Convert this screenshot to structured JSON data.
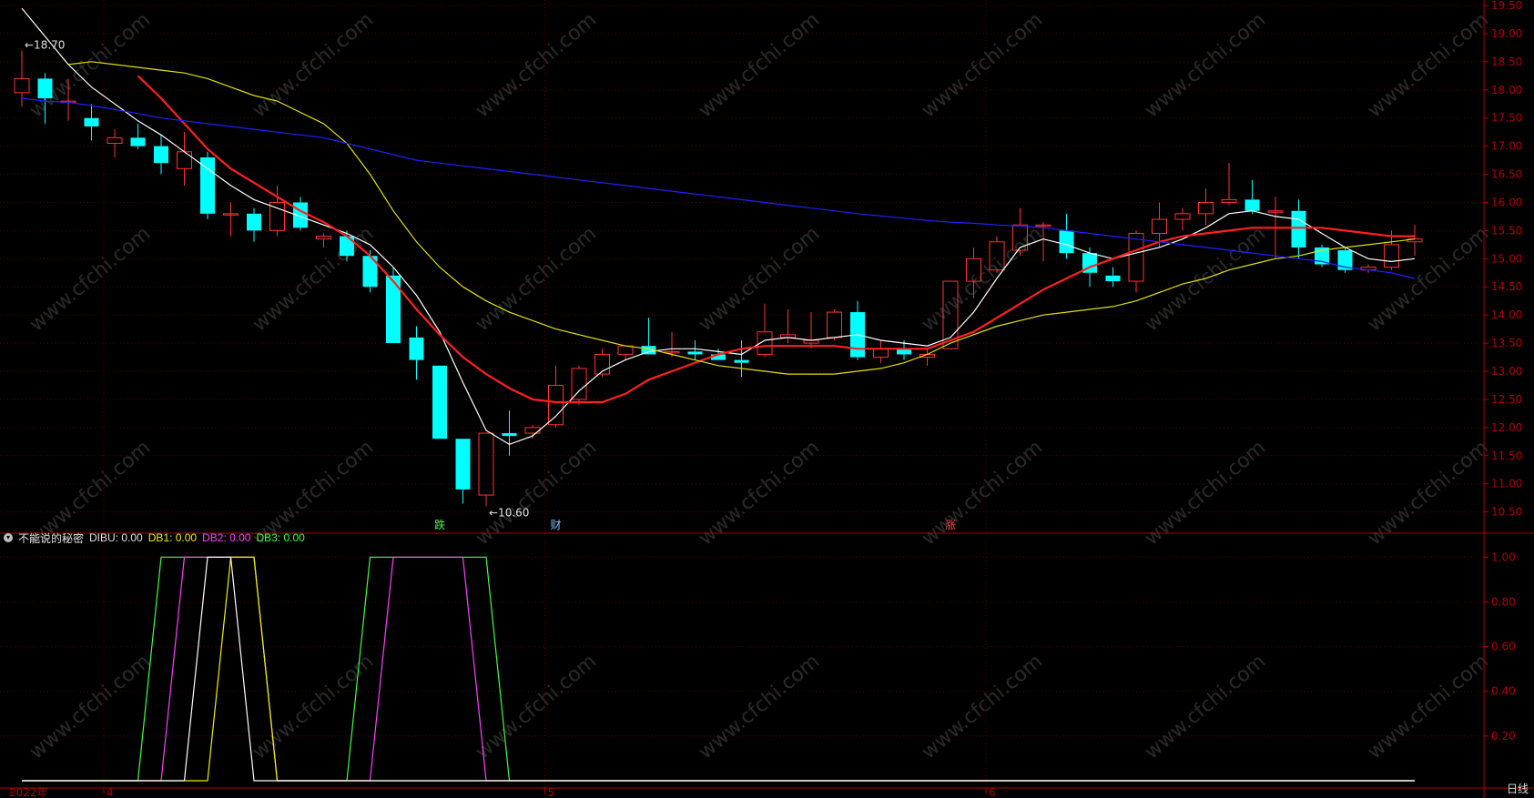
{
  "chart_data": [
    {
      "type": "candlestick",
      "ylim": [
        10.3,
        19.5
      ],
      "y_ticks": [
        "10.50",
        "11.00",
        "11.50",
        "12.00",
        "12.50",
        "13.00",
        "13.50",
        "14.00",
        "14.50",
        "15.00",
        "15.50",
        "16.00",
        "16.50",
        "17.00",
        "17.50",
        "18.00",
        "18.50",
        "19.00",
        "19.50"
      ],
      "price_annotations": [
        {
          "text": "18.70",
          "bar": 0,
          "value": 18.7
        },
        {
          "text": "10.60",
          "bar": 20,
          "value": 10.6
        }
      ],
      "event_markers": [
        {
          "text": "跌",
          "bar": 18,
          "color": "#40ff40"
        },
        {
          "text": "财",
          "bar": 23,
          "color": "#80c0ff"
        },
        {
          "text": "涨",
          "bar": 40,
          "color": "#ff4040"
        }
      ],
      "candles": [
        {
          "o": 17.95,
          "h": 18.7,
          "l": 17.7,
          "c": 18.2
        },
        {
          "o": 18.2,
          "h": 18.3,
          "l": 17.4,
          "c": 17.85
        },
        {
          "o": 17.8,
          "h": 18.2,
          "l": 17.45,
          "c": 17.8
        },
        {
          "o": 17.5,
          "h": 17.75,
          "l": 17.1,
          "c": 17.35
        },
        {
          "o": 17.05,
          "h": 17.3,
          "l": 16.8,
          "c": 17.15
        },
        {
          "o": 17.15,
          "h": 17.4,
          "l": 16.95,
          "c": 17.0
        },
        {
          "o": 17.0,
          "h": 17.2,
          "l": 16.5,
          "c": 16.7
        },
        {
          "o": 16.6,
          "h": 17.25,
          "l": 16.3,
          "c": 16.9
        },
        {
          "o": 16.8,
          "h": 16.9,
          "l": 15.7,
          "c": 15.8
        },
        {
          "o": 15.8,
          "h": 16.0,
          "l": 15.4,
          "c": 15.8
        },
        {
          "o": 15.8,
          "h": 15.9,
          "l": 15.3,
          "c": 15.5
        },
        {
          "o": 15.5,
          "h": 16.3,
          "l": 15.4,
          "c": 16.0
        },
        {
          "o": 16.0,
          "h": 16.1,
          "l": 15.5,
          "c": 15.55
        },
        {
          "o": 15.35,
          "h": 15.45,
          "l": 15.2,
          "c": 15.4
        },
        {
          "o": 15.4,
          "h": 15.5,
          "l": 14.95,
          "c": 15.05
        },
        {
          "o": 15.05,
          "h": 15.15,
          "l": 14.4,
          "c": 14.5
        },
        {
          "o": 14.7,
          "h": 14.85,
          "l": 13.5,
          "c": 13.5
        },
        {
          "o": 13.6,
          "h": 13.8,
          "l": 12.85,
          "c": 13.2
        },
        {
          "o": 13.1,
          "h": 13.1,
          "l": 11.8,
          "c": 11.8
        },
        {
          "o": 11.8,
          "h": 11.8,
          "l": 10.65,
          "c": 10.9
        },
        {
          "o": 10.8,
          "h": 11.9,
          "l": 10.6,
          "c": 11.9
        },
        {
          "o": 11.9,
          "h": 12.3,
          "l": 11.5,
          "c": 11.85
        },
        {
          "o": 11.9,
          "h": 12.05,
          "l": 11.8,
          "c": 12.0
        },
        {
          "o": 12.05,
          "h": 13.1,
          "l": 12.0,
          "c": 12.75
        },
        {
          "o": 12.5,
          "h": 13.1,
          "l": 12.4,
          "c": 13.05
        },
        {
          "o": 12.95,
          "h": 13.4,
          "l": 12.9,
          "c": 13.3
        },
        {
          "o": 13.3,
          "h": 13.45,
          "l": 13.2,
          "c": 13.45
        },
        {
          "o": 13.45,
          "h": 13.95,
          "l": 13.3,
          "c": 13.3
        },
        {
          "o": 13.35,
          "h": 13.7,
          "l": 13.25,
          "c": 13.35
        },
        {
          "o": 13.35,
          "h": 13.55,
          "l": 13.2,
          "c": 13.3
        },
        {
          "o": 13.3,
          "h": 13.4,
          "l": 13.2,
          "c": 13.2
        },
        {
          "o": 13.2,
          "h": 13.55,
          "l": 12.9,
          "c": 13.15
        },
        {
          "o": 13.3,
          "h": 14.2,
          "l": 13.25,
          "c": 13.7
        },
        {
          "o": 13.6,
          "h": 14.1,
          "l": 13.5,
          "c": 13.65
        },
        {
          "o": 13.5,
          "h": 14.05,
          "l": 13.4,
          "c": 13.55
        },
        {
          "o": 13.6,
          "h": 14.1,
          "l": 13.55,
          "c": 14.05
        },
        {
          "o": 14.05,
          "h": 14.25,
          "l": 13.2,
          "c": 13.25
        },
        {
          "o": 13.25,
          "h": 13.55,
          "l": 13.15,
          "c": 13.4
        },
        {
          "o": 13.4,
          "h": 13.55,
          "l": 13.2,
          "c": 13.3
        },
        {
          "o": 13.25,
          "h": 13.4,
          "l": 13.1,
          "c": 13.3
        },
        {
          "o": 13.4,
          "h": 14.6,
          "l": 13.4,
          "c": 14.6
        },
        {
          "o": 14.6,
          "h": 15.2,
          "l": 14.3,
          "c": 15.0
        },
        {
          "o": 14.8,
          "h": 15.4,
          "l": 14.75,
          "c": 15.3
        },
        {
          "o": 15.15,
          "h": 15.9,
          "l": 15.05,
          "c": 15.6
        },
        {
          "o": 15.6,
          "h": 15.65,
          "l": 14.95,
          "c": 15.6
        },
        {
          "o": 15.5,
          "h": 15.8,
          "l": 15.0,
          "c": 15.1
        },
        {
          "o": 15.1,
          "h": 15.2,
          "l": 14.5,
          "c": 14.75
        },
        {
          "o": 14.7,
          "h": 14.85,
          "l": 14.5,
          "c": 14.6
        },
        {
          "o": 14.6,
          "h": 15.5,
          "l": 14.4,
          "c": 15.45
        },
        {
          "o": 15.45,
          "h": 16.0,
          "l": 15.2,
          "c": 15.7
        },
        {
          "o": 15.7,
          "h": 15.9,
          "l": 15.5,
          "c": 15.8
        },
        {
          "o": 15.8,
          "h": 16.25,
          "l": 15.6,
          "c": 16.0
        },
        {
          "o": 16.0,
          "h": 16.7,
          "l": 15.95,
          "c": 16.05
        },
        {
          "o": 16.05,
          "h": 16.4,
          "l": 15.8,
          "c": 15.85
        },
        {
          "o": 15.85,
          "h": 16.1,
          "l": 15.0,
          "c": 15.85
        },
        {
          "o": 15.85,
          "h": 16.05,
          "l": 15.0,
          "c": 15.2
        },
        {
          "o": 15.2,
          "h": 15.25,
          "l": 14.85,
          "c": 14.9
        },
        {
          "o": 15.15,
          "h": 15.2,
          "l": 14.75,
          "c": 14.8
        },
        {
          "o": 14.8,
          "h": 14.9,
          "l": 14.75,
          "c": 14.85
        },
        {
          "o": 14.85,
          "h": 15.5,
          "l": 14.8,
          "c": 15.25
        },
        {
          "o": 15.3,
          "h": 15.6,
          "l": 15.05,
          "c": 15.35
        }
      ],
      "series": [
        {
          "color": "#ffffff",
          "values": [
            19.45,
            18.95,
            18.45,
            18.05,
            17.75,
            17.45,
            17.2,
            16.9,
            16.6,
            16.3,
            16.05,
            15.9,
            15.75,
            15.6,
            15.45,
            15.25,
            14.85,
            14.35,
            13.7,
            12.8,
            11.95,
            11.7,
            11.85,
            12.2,
            12.65,
            13.0,
            13.2,
            13.35,
            13.4,
            13.4,
            13.35,
            13.3,
            13.55,
            13.6,
            13.55,
            13.6,
            13.65,
            13.55,
            13.5,
            13.45,
            13.6,
            14.05,
            14.65,
            15.2,
            15.35,
            15.25,
            15.1,
            15.0,
            15.1,
            15.2,
            15.35,
            15.55,
            15.8,
            15.85,
            15.75,
            15.7,
            15.45,
            15.2,
            15.0,
            14.95,
            15.0
          ]
        },
        {
          "color": "#ff2020",
          "values": [
            null,
            null,
            null,
            null,
            null,
            18.25,
            17.85,
            17.4,
            16.95,
            16.6,
            16.35,
            16.1,
            15.85,
            15.65,
            15.4,
            15.05,
            14.6,
            14.1,
            13.65,
            13.25,
            12.95,
            12.7,
            12.5,
            12.45,
            12.45,
            12.45,
            12.6,
            12.85,
            13.0,
            13.15,
            13.3,
            13.4,
            13.45,
            13.45,
            13.45,
            13.45,
            13.4,
            13.4,
            13.4,
            13.4,
            13.55,
            13.7,
            13.95,
            14.2,
            14.45,
            14.65,
            14.85,
            15.0,
            15.15,
            15.3,
            15.4,
            15.45,
            15.5,
            15.55,
            15.55,
            15.55,
            15.55,
            15.5,
            15.45,
            15.4,
            15.4
          ]
        },
        {
          "color": "#e0e000",
          "values": [
            null,
            null,
            18.45,
            18.5,
            18.45,
            18.4,
            18.35,
            18.3,
            18.2,
            18.05,
            17.9,
            17.8,
            17.6,
            17.4,
            17.05,
            16.5,
            15.85,
            15.3,
            14.85,
            14.5,
            14.25,
            14.05,
            13.9,
            13.75,
            13.65,
            13.55,
            13.45,
            13.4,
            13.3,
            13.2,
            13.1,
            13.05,
            13.0,
            12.95,
            12.95,
            12.95,
            13.0,
            13.05,
            13.15,
            13.3,
            13.5,
            13.65,
            13.8,
            13.9,
            14.0,
            14.05,
            14.1,
            14.15,
            14.25,
            14.4,
            14.55,
            14.65,
            14.8,
            14.9,
            15.0,
            15.05,
            15.15,
            15.2,
            15.25,
            15.3,
            15.35
          ]
        },
        {
          "color": "#2020ff",
          "values": [
            17.85,
            17.8,
            17.78,
            17.72,
            17.65,
            17.58,
            17.5,
            17.45,
            17.4,
            17.35,
            17.3,
            17.25,
            17.2,
            17.15,
            17.05,
            16.95,
            16.85,
            16.75,
            16.7,
            16.65,
            16.6,
            16.55,
            16.5,
            16.45,
            16.4,
            16.35,
            16.3,
            16.25,
            16.2,
            16.15,
            16.1,
            16.05,
            16.0,
            15.95,
            15.9,
            15.85,
            15.8,
            15.76,
            15.72,
            15.68,
            15.65,
            15.63,
            15.6,
            15.58,
            15.55,
            15.5,
            15.45,
            15.4,
            15.35,
            15.3,
            15.25,
            15.2,
            15.15,
            15.1,
            15.05,
            15.0,
            14.95,
            14.85,
            14.8,
            14.75,
            14.65
          ]
        }
      ]
    },
    {
      "type": "line",
      "ylim": [
        0,
        1.05
      ],
      "y_ticks": [
        "0.20",
        "0.40",
        "0.60",
        "0.80",
        "1.00"
      ],
      "series": [
        {
          "name": "DIBU",
          "color": "#ffffff",
          "values": [
            0,
            0,
            0,
            0,
            0,
            0,
            0,
            0,
            1,
            1,
            0,
            0,
            0,
            0,
            0,
            0,
            0,
            0,
            0,
            0,
            0,
            0,
            0,
            0,
            0,
            0,
            0,
            0,
            0,
            0,
            0,
            0,
            0,
            0,
            0,
            0,
            0,
            0,
            0,
            0,
            0,
            0,
            0,
            0,
            0,
            0,
            0,
            0,
            0,
            0,
            0,
            0,
            0,
            0,
            0,
            0,
            0,
            0,
            0,
            0,
            0
          ]
        },
        {
          "name": "DB1",
          "color": "#f0f000",
          "values": [
            0,
            0,
            0,
            0,
            0,
            0,
            0,
            0,
            0,
            1,
            1,
            0,
            0,
            0,
            0,
            0,
            0,
            0,
            0,
            0,
            0,
            0,
            0,
            0,
            0,
            0,
            0,
            0,
            0,
            0,
            0,
            0,
            0,
            0,
            0,
            0,
            0,
            0,
            0,
            0,
            0,
            0,
            0,
            0,
            0,
            0,
            0,
            0,
            0,
            0,
            0,
            0,
            0,
            0,
            0,
            0,
            0,
            0,
            0,
            0,
            0
          ]
        },
        {
          "name": "DB2",
          "color": "#ff40ff",
          "values": [
            0,
            0,
            0,
            0,
            0,
            0,
            0,
            1,
            1,
            1,
            1,
            0,
            0,
            0,
            0,
            0,
            1,
            1,
            1,
            1,
            0,
            0,
            0,
            0,
            0,
            0,
            0,
            0,
            0,
            0,
            0,
            0,
            0,
            0,
            0,
            0,
            0,
            0,
            0,
            0,
            0,
            0,
            0,
            0,
            0,
            0,
            0,
            0,
            0,
            0,
            0,
            0,
            0,
            0,
            0,
            0,
            0,
            0,
            0,
            0,
            0
          ]
        },
        {
          "name": "DB3",
          "color": "#40ff40",
          "values": [
            0,
            0,
            0,
            0,
            0,
            0,
            1,
            1,
            1,
            1,
            1,
            0,
            0,
            0,
            0,
            1,
            1,
            1,
            1,
            1,
            1,
            0,
            0,
            0,
            0,
            0,
            0,
            0,
            0,
            0,
            0,
            0,
            0,
            0,
            0,
            0,
            0,
            0,
            0,
            0,
            0,
            0,
            0,
            0,
            0,
            0,
            0,
            0,
            0,
            0,
            0,
            0,
            0,
            0,
            0,
            0,
            0,
            0,
            0,
            0,
            0
          ]
        }
      ]
    }
  ],
  "indicator": {
    "name": "不能说的秘密",
    "dibu": "DIBU: 0.00",
    "db1": "DB1: 0.00",
    "db2": "DB2: 0.00",
    "db3": "DB3: 0.00"
  },
  "x_labels": [
    {
      "text": "2022年",
      "bar": 0
    },
    {
      "text": "4",
      "bar": 4
    },
    {
      "text": "5",
      "bar": 23
    },
    {
      "text": "6",
      "bar": 42
    }
  ],
  "period_label": "日线",
  "watermark": "www.cfchi.com",
  "colors": {
    "up": "#ff3232",
    "down": "#00ffff",
    "axis": "#b00000",
    "text": "#c0c0c0"
  }
}
